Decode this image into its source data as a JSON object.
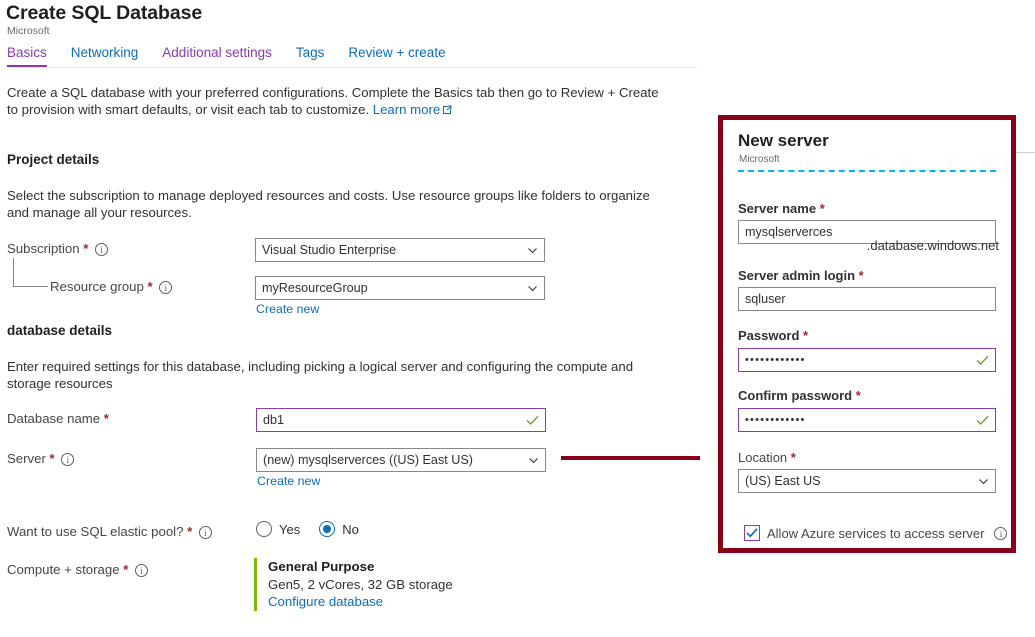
{
  "header": {
    "title": "Create SQL Database",
    "subtitle": "Microsoft"
  },
  "tabs": [
    {
      "label": "Basics",
      "state": "active"
    },
    {
      "label": "Networking",
      "state": "blue"
    },
    {
      "label": "Additional settings",
      "state": "purple"
    },
    {
      "label": "Tags",
      "state": "blue"
    },
    {
      "label": "Review + create",
      "state": "blue"
    }
  ],
  "intro": {
    "text": "Create a SQL database with your preferred configurations. Complete the Basics tab then go to Review + Create to provision with smart defaults, or visit each tab to customize. ",
    "link_label": "Learn more"
  },
  "project_details": {
    "heading": "Project details",
    "description": "Select the subscription to manage deployed resources and costs. Use resource groups like folders to organize and manage all your resources.",
    "subscription": {
      "label": "Subscription",
      "required": "*",
      "value": "Visual Studio Enterprise"
    },
    "resource_group": {
      "label": "Resource group",
      "required": "*",
      "value": "myResourceGroup",
      "create_new_label": "Create new"
    }
  },
  "database_details": {
    "heading": "database details",
    "description": "Enter required settings for this database, including picking a logical server and configuring the compute and storage resources",
    "database_name": {
      "label": "Database name",
      "required": "*",
      "value": "db1"
    },
    "server": {
      "label": "Server",
      "required": "*",
      "value": "(new) mysqlserverces ((US) East US)",
      "create_new_label": "Create new"
    },
    "elastic_pool": {
      "label": "Want to use SQL elastic pool?",
      "required": "*",
      "options": [
        "Yes",
        "No"
      ],
      "selected": "No"
    },
    "compute_storage": {
      "label": "Compute + storage",
      "required": "*",
      "tier": "General Purpose",
      "specs": "Gen5, 2 vCores, 32 GB storage",
      "configure_label": "Configure database"
    }
  },
  "new_server_panel": {
    "title": "New server",
    "subtitle": "Microsoft",
    "server_name": {
      "label": "Server name",
      "required": "*",
      "value": "mysqlserverces",
      "suffix": ".database.windows.net"
    },
    "server_admin_login": {
      "label": "Server admin login",
      "required": "*",
      "value": "sqluser"
    },
    "password": {
      "label": "Password",
      "required": "*",
      "value": "••••••••••••"
    },
    "confirm_password": {
      "label": "Confirm password",
      "required": "*",
      "value": "••••••••••••"
    },
    "location": {
      "label": "Location",
      "required": "*",
      "value": "(US) East US"
    },
    "allow_azure": {
      "label": "Allow Azure services to access server",
      "checked": true
    }
  },
  "colors": {
    "accent_purple": "#8a3ab0",
    "link_blue": "#0f6cbd",
    "required_red": "#a4262c",
    "annotation_red": "#8a0019",
    "valid_green": "#7fba00",
    "divider_cyan": "#00b7f0"
  }
}
